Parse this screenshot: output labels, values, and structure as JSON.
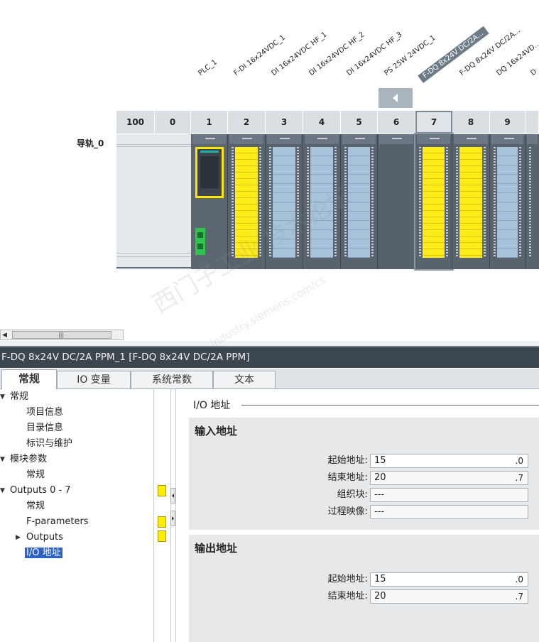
{
  "device_view": {
    "module_labels": [
      "PLC_1",
      "F-DI 16x24VDC_1",
      "DI 16x24VDC HF_1",
      "DI 16x24VDC HF_2",
      "DI 16x24VDC HF_3",
      "PS 25W 24VDC_1",
      "F-DQ 8x24V DC/2A...",
      "F-DQ 8x24V DC/2A...",
      "DQ 16x24VD...",
      "D"
    ],
    "slot_numbers": [
      "100",
      "0",
      "1",
      "2",
      "3",
      "4",
      "5",
      "6",
      "7",
      "8",
      "9"
    ],
    "rail_label": "导轨_0",
    "selected_slot": "7"
  },
  "watermark": {
    "line1": "西门子工业  技术论坛",
    "line2": "industry.siemens.com/cs"
  },
  "panel": {
    "title": "F-DQ 8x24V DC/2A PPM_1 [F-DQ 8x24V DC/2A PPM]",
    "tabs": [
      "常规",
      "IO 变量",
      "系统常数",
      "文本"
    ],
    "active_tab": "常规",
    "tree": [
      {
        "label": "常规",
        "expander": "▼"
      },
      {
        "label": "项目信息",
        "expander": ""
      },
      {
        "label": "目录信息",
        "expander": ""
      },
      {
        "label": "标识与维护",
        "expander": ""
      },
      {
        "label": "模块参数",
        "expander": "▼"
      },
      {
        "label": "常规",
        "expander": ""
      },
      {
        "label": "Outputs 0 - 7",
        "expander": "▼"
      },
      {
        "label": "常规",
        "expander": ""
      },
      {
        "label": "F-parameters",
        "expander": ""
      },
      {
        "label": "Outputs",
        "expander": "▶"
      },
      {
        "label": "I/O 地址",
        "expander": ""
      }
    ],
    "selected_tree_item": "I/O 地址",
    "section_heading": "I/O 地址",
    "input_section": {
      "title": "输入地址",
      "start_label": "起始地址:",
      "start_value": "15",
      "start_suffix": ".0",
      "end_label": "结束地址:",
      "end_value": "20",
      "end_suffix": ".7",
      "ob_label": "组织块:",
      "ob_value": "---",
      "pi_label": "过程映像:",
      "pi_value": "---"
    },
    "output_section": {
      "title": "输出地址",
      "start_label": "起始地址:",
      "start_value": "15",
      "start_suffix": ".0",
      "end_label": "结束地址:",
      "end_value": "20",
      "end_suffix": ".7"
    }
  },
  "colors": {
    "title_bar": "#3c464e",
    "safety_yellow": "#ffee00",
    "selection_blue": "#2e62c7"
  }
}
